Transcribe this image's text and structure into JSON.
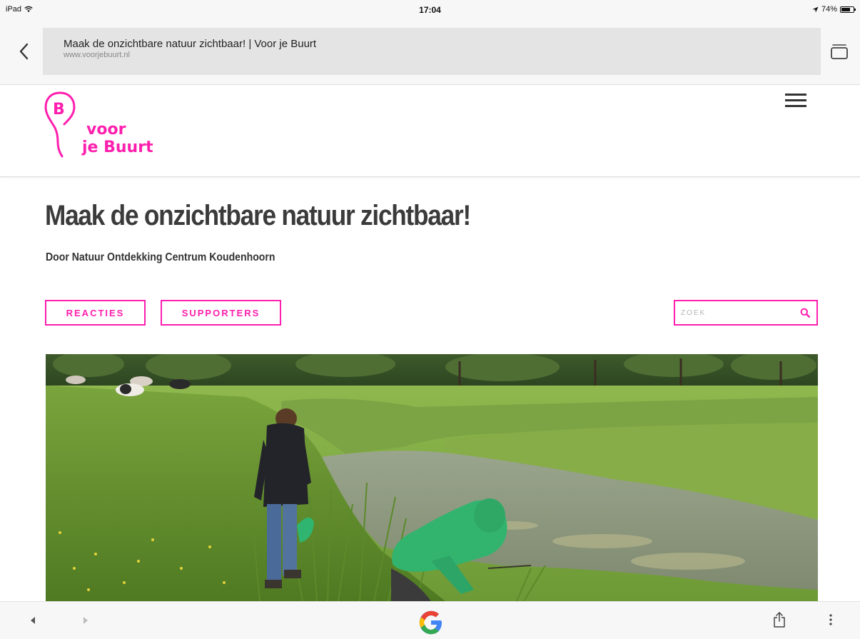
{
  "status_bar": {
    "device": "iPad",
    "time": "17:04",
    "battery": "74%",
    "battery_level": 0.74
  },
  "browser": {
    "page_title": "Maak de onzichtbare natuur zichtbaar! | Voor je Buurt",
    "domain": "www.voorjebuurt.nl"
  },
  "header": {
    "logo": {
      "letter": "B",
      "line1": "voor",
      "line2": "je Buurt"
    }
  },
  "main": {
    "title": "Maak de onzichtbare natuur zichtbaar!",
    "byline": "Door Natuur Ontdekking Centrum Koudenhoorn",
    "buttons": {
      "reacties": "REACTIES",
      "supporters": "SUPPORTERS"
    },
    "search": {
      "placeholder": "ZOEK"
    }
  },
  "colors": {
    "brand_pink": "#ff1fae",
    "text_dark": "#3b3b3b"
  },
  "icons": {
    "back": "chevron-left-icon",
    "tabs": "tabs-icon",
    "menu": "hamburger-menu-icon",
    "search": "search-icon",
    "share": "share-icon",
    "more": "more-vertical-icon",
    "google": "google-logo-icon"
  }
}
